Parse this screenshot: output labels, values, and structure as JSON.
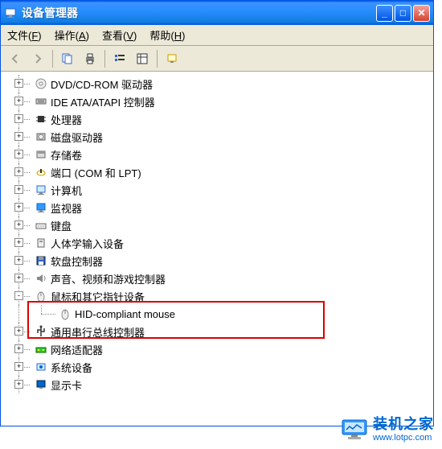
{
  "window": {
    "title": "设备管理器"
  },
  "menu": {
    "file": "文件(",
    "file_u": "F",
    "op": "操作(",
    "op_u": "A",
    "view": "查看(",
    "view_u": "V",
    "help": "帮助(",
    "help_u": "H",
    "close": ")"
  },
  "toolbar": {
    "back": "back-icon",
    "forward": "forward-icon",
    "pages": "pages-icon",
    "print": "print-icon",
    "list": "list-icon",
    "detail": "detail-icon",
    "refresh": "refresh-icon"
  },
  "tree": [
    {
      "icon": "dvd",
      "label": "DVD/CD-ROM 驱动器",
      "exp": "+"
    },
    {
      "icon": "ide",
      "label": "IDE ATA/ATAPI 控制器",
      "exp": "+"
    },
    {
      "icon": "cpu",
      "label": "处理器",
      "exp": "+"
    },
    {
      "icon": "disk",
      "label": "磁盘驱动器",
      "exp": "+"
    },
    {
      "icon": "vol",
      "label": "存储卷",
      "exp": "+"
    },
    {
      "icon": "port",
      "label": "端口 (COM 和 LPT)",
      "exp": "+"
    },
    {
      "icon": "computer",
      "label": "计算机",
      "exp": "+"
    },
    {
      "icon": "monitor",
      "label": "监视器",
      "exp": "+"
    },
    {
      "icon": "keyboard",
      "label": "键盘",
      "exp": "+"
    },
    {
      "icon": "hid",
      "label": "人体学输入设备",
      "exp": "+"
    },
    {
      "icon": "floppy",
      "label": "软盘控制器",
      "exp": "+"
    },
    {
      "icon": "sound",
      "label": "声音、视频和游戏控制器",
      "exp": "+"
    },
    {
      "icon": "mouse",
      "label": "鼠标和其它指针设备",
      "exp": "-",
      "child": {
        "icon": "mouse",
        "label": "HID-compliant mouse"
      }
    },
    {
      "icon": "usb",
      "label": "通用串行总线控制器",
      "exp": "+"
    },
    {
      "icon": "net",
      "label": "网络适配器",
      "exp": "+"
    },
    {
      "icon": "system",
      "label": "系统设备",
      "exp": "+"
    },
    {
      "icon": "display",
      "label": "显示卡",
      "exp": "+"
    }
  ],
  "watermark": {
    "title": "装机之家",
    "url": "www.lotpc.com"
  }
}
